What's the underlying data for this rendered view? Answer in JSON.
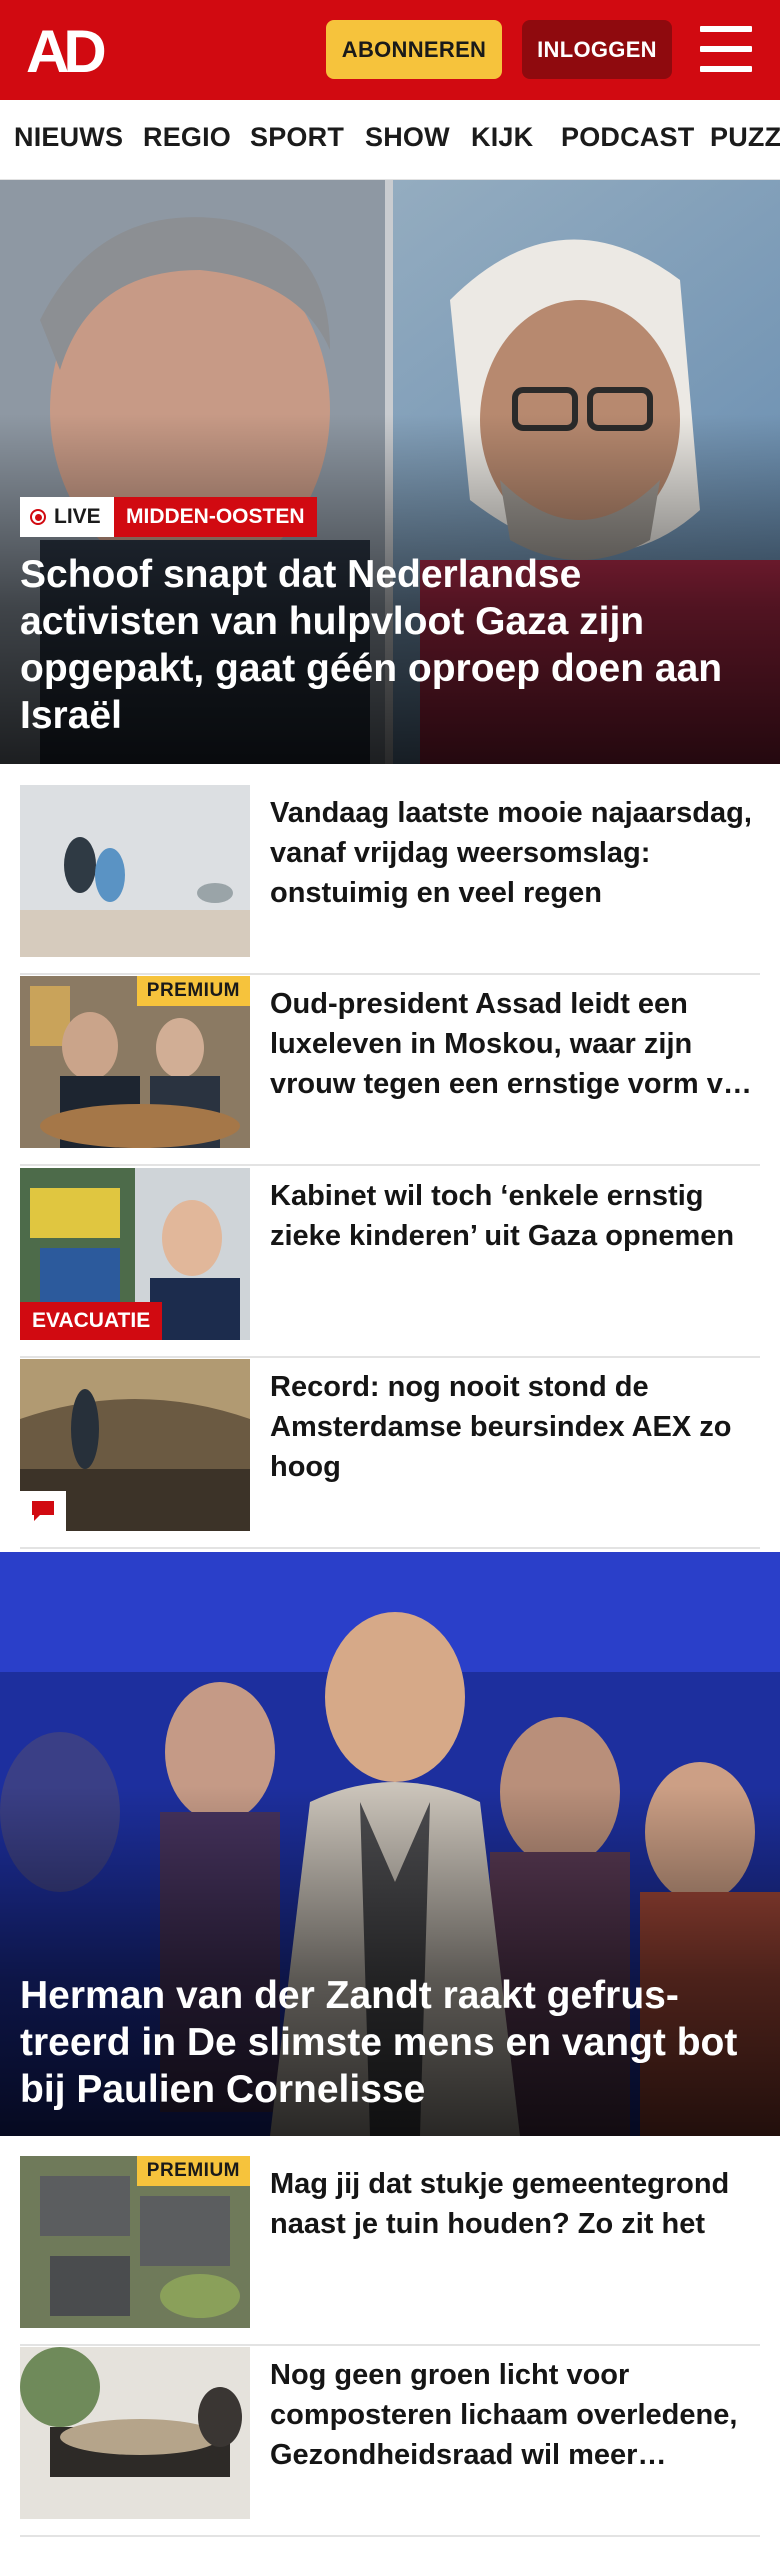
{
  "header": {
    "logo_text": "AD",
    "subscribe_label": "ABONNEREN",
    "login_label": "INLOGGEN",
    "brand_color": "#d10a11",
    "menu_icon": "hamburger-menu-icon"
  },
  "nav": {
    "items": [
      "NIEUWS",
      "REGIO",
      "SPORT",
      "SHOW",
      "KIJK",
      "PODCAST",
      "PUZZ"
    ]
  },
  "hero1": {
    "live_label": "LIVE",
    "category": "MIDDEN-OOSTEN",
    "title": "Schoof snapt dat Nederlandse activisten van hulpvloot Gaza zijn opgepakt, gaat géén oproep doen aan Israël"
  },
  "articles1": [
    {
      "title": "Vandaag laatste mooie najaarsdag, vanaf vrijdag weersomslag: onstuimig en veel regen"
    },
    {
      "title": "Oud-president Assad leidt een luxeleven in Moskou, waar zijn vrouw tegen een ernstige vorm van kanker vecht",
      "badge": "PREMIUM"
    },
    {
      "title": "Kabinet wil toch ‘enkele ernstig zieke kinderen’ uit Gaza opnemen",
      "tag": "EVACUATIE"
    },
    {
      "title": "Record: nog nooit stond de Amsterdamse beursindex AEX zo hoog",
      "icon": "comment-icon"
    }
  ],
  "hero2": {
    "title": "Herman van der Zandt raakt gefrus­treerd in De slimste mens en vangt bot bij Paulien Cornelisse"
  },
  "articles2": [
    {
      "title": "Mag jij dat stukje gemeentegrond naast je tuin houden? Zo zit het",
      "badge": "PREMIUM"
    },
    {
      "title": "Nog geen groen licht voor composteren lichaam overledene, Gezondheidsraad wil meer onderzoek"
    }
  ]
}
